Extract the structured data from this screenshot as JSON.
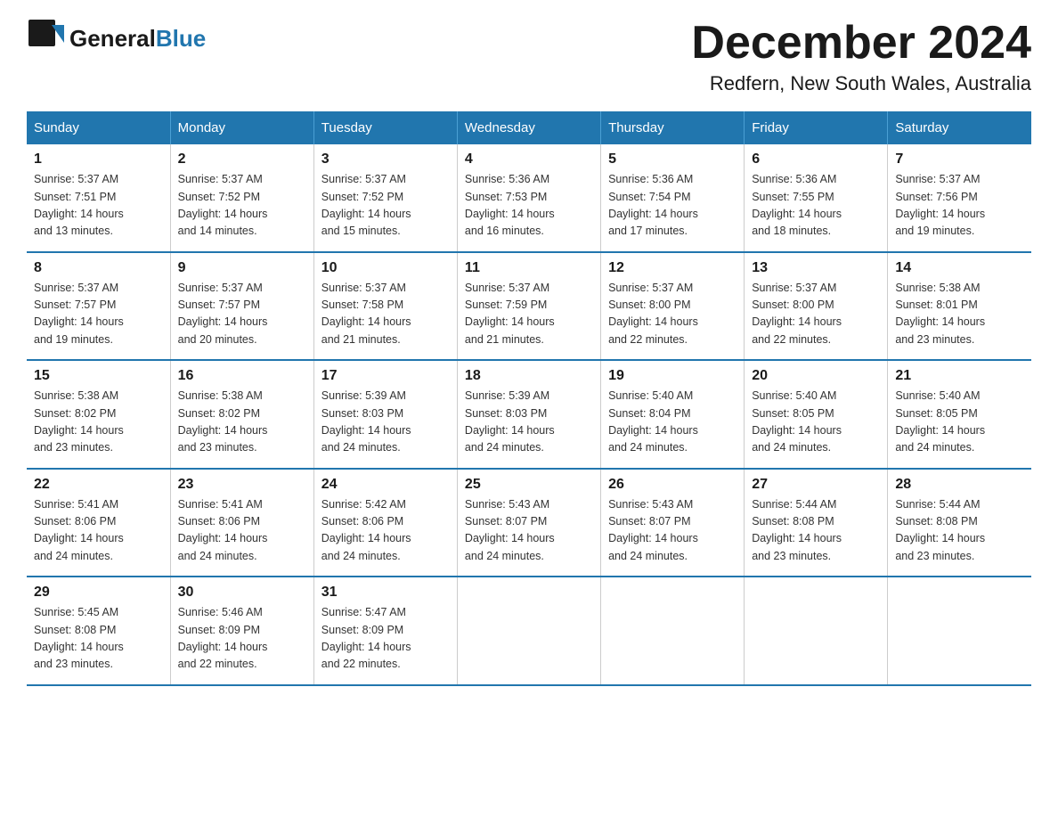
{
  "header": {
    "logo_general": "General",
    "logo_blue": "Blue",
    "month_title": "December 2024",
    "location": "Redfern, New South Wales, Australia"
  },
  "days_of_week": [
    "Sunday",
    "Monday",
    "Tuesday",
    "Wednesday",
    "Thursday",
    "Friday",
    "Saturday"
  ],
  "weeks": [
    [
      {
        "day": "1",
        "sunrise": "5:37 AM",
        "sunset": "7:51 PM",
        "daylight": "14 hours and 13 minutes."
      },
      {
        "day": "2",
        "sunrise": "5:37 AM",
        "sunset": "7:52 PM",
        "daylight": "14 hours and 14 minutes."
      },
      {
        "day": "3",
        "sunrise": "5:37 AM",
        "sunset": "7:52 PM",
        "daylight": "14 hours and 15 minutes."
      },
      {
        "day": "4",
        "sunrise": "5:36 AM",
        "sunset": "7:53 PM",
        "daylight": "14 hours and 16 minutes."
      },
      {
        "day": "5",
        "sunrise": "5:36 AM",
        "sunset": "7:54 PM",
        "daylight": "14 hours and 17 minutes."
      },
      {
        "day": "6",
        "sunrise": "5:36 AM",
        "sunset": "7:55 PM",
        "daylight": "14 hours and 18 minutes."
      },
      {
        "day": "7",
        "sunrise": "5:37 AM",
        "sunset": "7:56 PM",
        "daylight": "14 hours and 19 minutes."
      }
    ],
    [
      {
        "day": "8",
        "sunrise": "5:37 AM",
        "sunset": "7:57 PM",
        "daylight": "14 hours and 19 minutes."
      },
      {
        "day": "9",
        "sunrise": "5:37 AM",
        "sunset": "7:57 PM",
        "daylight": "14 hours and 20 minutes."
      },
      {
        "day": "10",
        "sunrise": "5:37 AM",
        "sunset": "7:58 PM",
        "daylight": "14 hours and 21 minutes."
      },
      {
        "day": "11",
        "sunrise": "5:37 AM",
        "sunset": "7:59 PM",
        "daylight": "14 hours and 21 minutes."
      },
      {
        "day": "12",
        "sunrise": "5:37 AM",
        "sunset": "8:00 PM",
        "daylight": "14 hours and 22 minutes."
      },
      {
        "day": "13",
        "sunrise": "5:37 AM",
        "sunset": "8:00 PM",
        "daylight": "14 hours and 22 minutes."
      },
      {
        "day": "14",
        "sunrise": "5:38 AM",
        "sunset": "8:01 PM",
        "daylight": "14 hours and 23 minutes."
      }
    ],
    [
      {
        "day": "15",
        "sunrise": "5:38 AM",
        "sunset": "8:02 PM",
        "daylight": "14 hours and 23 minutes."
      },
      {
        "day": "16",
        "sunrise": "5:38 AM",
        "sunset": "8:02 PM",
        "daylight": "14 hours and 23 minutes."
      },
      {
        "day": "17",
        "sunrise": "5:39 AM",
        "sunset": "8:03 PM",
        "daylight": "14 hours and 24 minutes."
      },
      {
        "day": "18",
        "sunrise": "5:39 AM",
        "sunset": "8:03 PM",
        "daylight": "14 hours and 24 minutes."
      },
      {
        "day": "19",
        "sunrise": "5:40 AM",
        "sunset": "8:04 PM",
        "daylight": "14 hours and 24 minutes."
      },
      {
        "day": "20",
        "sunrise": "5:40 AM",
        "sunset": "8:05 PM",
        "daylight": "14 hours and 24 minutes."
      },
      {
        "day": "21",
        "sunrise": "5:40 AM",
        "sunset": "8:05 PM",
        "daylight": "14 hours and 24 minutes."
      }
    ],
    [
      {
        "day": "22",
        "sunrise": "5:41 AM",
        "sunset": "8:06 PM",
        "daylight": "14 hours and 24 minutes."
      },
      {
        "day": "23",
        "sunrise": "5:41 AM",
        "sunset": "8:06 PM",
        "daylight": "14 hours and 24 minutes."
      },
      {
        "day": "24",
        "sunrise": "5:42 AM",
        "sunset": "8:06 PM",
        "daylight": "14 hours and 24 minutes."
      },
      {
        "day": "25",
        "sunrise": "5:43 AM",
        "sunset": "8:07 PM",
        "daylight": "14 hours and 24 minutes."
      },
      {
        "day": "26",
        "sunrise": "5:43 AM",
        "sunset": "8:07 PM",
        "daylight": "14 hours and 24 minutes."
      },
      {
        "day": "27",
        "sunrise": "5:44 AM",
        "sunset": "8:08 PM",
        "daylight": "14 hours and 23 minutes."
      },
      {
        "day": "28",
        "sunrise": "5:44 AM",
        "sunset": "8:08 PM",
        "daylight": "14 hours and 23 minutes."
      }
    ],
    [
      {
        "day": "29",
        "sunrise": "5:45 AM",
        "sunset": "8:08 PM",
        "daylight": "14 hours and 23 minutes."
      },
      {
        "day": "30",
        "sunrise": "5:46 AM",
        "sunset": "8:09 PM",
        "daylight": "14 hours and 22 minutes."
      },
      {
        "day": "31",
        "sunrise": "5:47 AM",
        "sunset": "8:09 PM",
        "daylight": "14 hours and 22 minutes."
      },
      null,
      null,
      null,
      null
    ]
  ],
  "labels": {
    "sunrise": "Sunrise:",
    "sunset": "Sunset:",
    "daylight": "Daylight:"
  },
  "colors": {
    "header_bg": "#2176ae",
    "accent": "#1a6faf"
  }
}
